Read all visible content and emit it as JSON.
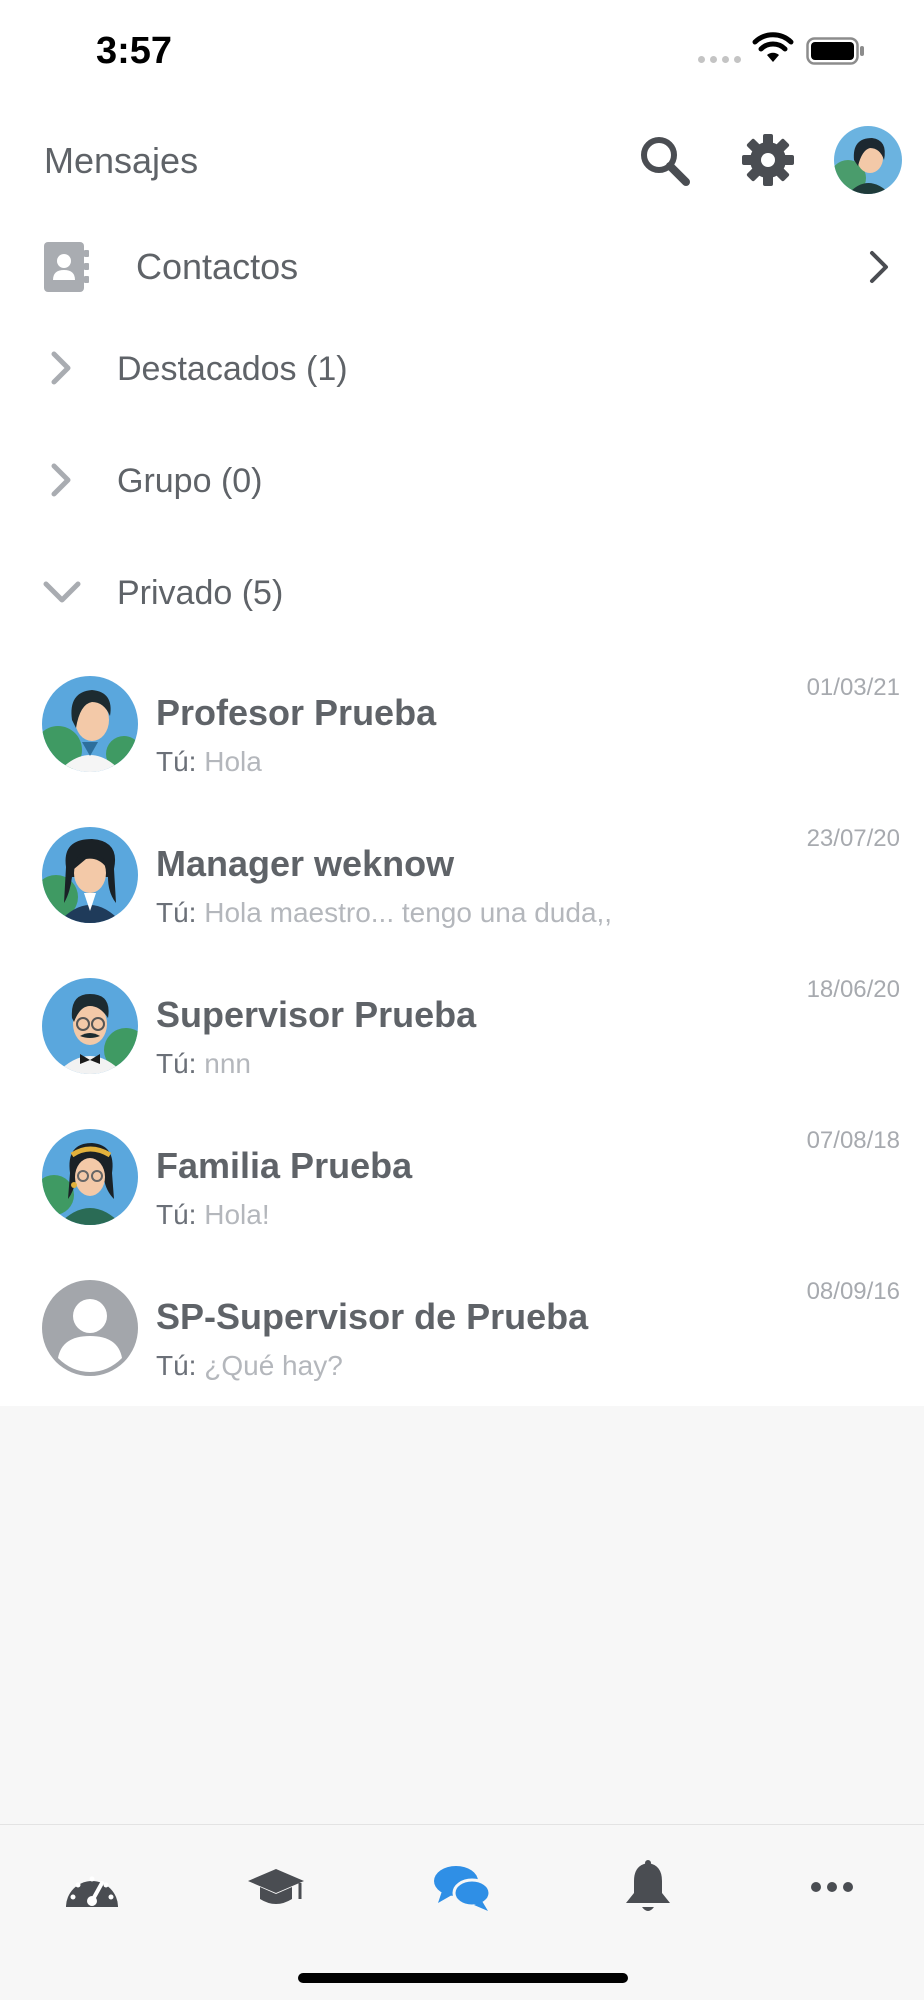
{
  "status_bar": {
    "time": "3:57"
  },
  "header": {
    "title": "Mensajes"
  },
  "contacts": {
    "label": "Contactos"
  },
  "sections": {
    "destacados": "Destacados (1)",
    "grupo": "Grupo (0)",
    "privado": "Privado (5)"
  },
  "conversations": [
    {
      "name": "Profesor Prueba",
      "you": "Tú:",
      "preview": "Hola",
      "date": "01/03/21"
    },
    {
      "name": "Manager weknow",
      "you": "Tú:",
      "preview": "Hola maestro... tengo una duda,,",
      "date": "23/07/20"
    },
    {
      "name": "Supervisor Prueba",
      "you": "Tú:",
      "preview": "nnn",
      "date": "18/06/20"
    },
    {
      "name": "Familia Prueba",
      "you": "Tú:",
      "preview": "Hola!",
      "date": "07/08/18"
    },
    {
      "name": "SP-Supervisor de Prueba",
      "you": "Tú:",
      "preview": "¿Qué hay?",
      "date": "08/09/16"
    }
  ],
  "colors": {
    "text": "#5f6368",
    "muted": "#b4b7bc",
    "accent": "#2f8fe6",
    "background_empty": "#f7f7f7"
  },
  "icons": {
    "header": [
      "search-icon",
      "gear-icon",
      "avatar"
    ],
    "tabs": [
      "dashboard-icon",
      "graduation-cap-icon",
      "chat-bubbles-icon",
      "bell-icon",
      "more-icon"
    ]
  },
  "tabs": {
    "active": "messages"
  }
}
